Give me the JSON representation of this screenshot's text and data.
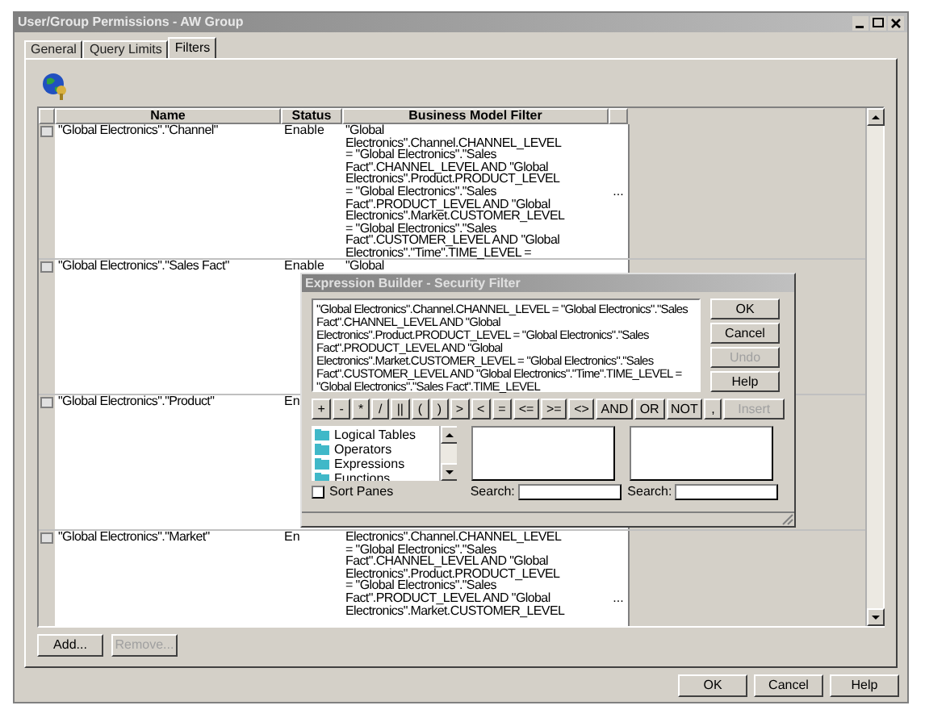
{
  "window": {
    "title": "User/Group Permissions - AW Group"
  },
  "tabs": [
    {
      "label": "General",
      "selected": false
    },
    {
      "label": "Query Limits",
      "selected": false
    },
    {
      "label": "Filters",
      "selected": true
    }
  ],
  "table": {
    "columns": [
      "Name",
      "Status",
      "Business Model Filter"
    ],
    "rows": [
      {
        "name": "\"Global Electronics\".\"Channel\"",
        "status": "Enable",
        "filter_lines": [
          "\"Global",
          "Electronics\".Channel.CHANNEL_LEVEL",
          "= \"Global Electronics\".\"Sales",
          "Fact\".CHANNEL_LEVEL AND \"Global",
          "Electronics\".Product.PRODUCT_LEVEL",
          "= \"Global Electronics\".\"Sales",
          "Fact\".PRODUCT_LEVEL AND \"Global",
          "Electronics\".Market.CUSTOMER_LEVEL",
          "= \"Global Electronics\".\"Sales",
          "Fact\".CUSTOMER_LEVEL AND \"Global",
          "Electronics\".\"Time\".TIME_LEVEL ="
        ],
        "edit_button": "..."
      },
      {
        "name": "\"Global Electronics\".\"Sales Fact\"",
        "status": "Enable",
        "filter_lines": [
          "\"Global"
        ]
      },
      {
        "name": "\"Global Electronics\".\"Product\"",
        "status": "En"
      },
      {
        "name": "\"Global Electronics\".\"Market\"",
        "status": "En",
        "filter_lines": [
          "Electronics\".Channel.CHANNEL_LEVEL",
          "= \"Global Electronics\".\"Sales",
          "Fact\".CHANNEL_LEVEL AND \"Global",
          "Electronics\".Product.PRODUCT_LEVEL",
          "= \"Global Electronics\".\"Sales",
          "Fact\".PRODUCT_LEVEL AND \"Global",
          "Electronics\".Market.CUSTOMER_LEVEL"
        ],
        "edit_button": "..."
      }
    ]
  },
  "list_buttons": [
    {
      "label": "Add...",
      "disabled": false
    },
    {
      "label": "Remove...",
      "disabled": true
    }
  ],
  "dialog": {
    "title": "Expression Builder - Security Filter",
    "expression": "\"Global Electronics\".Channel.CHANNEL_LEVEL = \"Global Electronics\".\"Sales Fact\".CHANNEL_LEVEL AND \"Global Electronics\".Product.PRODUCT_LEVEL = \"Global Electronics\".\"Sales Fact\".PRODUCT_LEVEL AND \"Global Electronics\".Market.CUSTOMER_LEVEL = \"Global Electronics\".\"Sales Fact\".CUSTOMER_LEVEL AND \"Global Electronics\".\"Time\".TIME_LEVEL = \"Global Electronics\".\"Sales Fact\".TIME_LEVEL",
    "side_buttons": [
      {
        "label": "OK",
        "disabled": false
      },
      {
        "label": "Cancel",
        "disabled": false
      },
      {
        "label": "Undo",
        "disabled": true
      },
      {
        "label": "Help",
        "disabled": false
      }
    ],
    "operators": [
      "+",
      "-",
      "*",
      "/",
      "||",
      "(",
      ")",
      ">",
      "<",
      "=",
      "<=",
      ">=",
      "<>",
      "AND",
      "OR",
      "NOT",
      ","
    ],
    "insert_button": {
      "label": "Insert",
      "disabled": true
    },
    "categories": [
      "Logical Tables",
      "Operators",
      "Expressions",
      "Functions"
    ],
    "sort_panes": {
      "label": "Sort Panes",
      "checked": false
    },
    "search_fields": [
      {
        "label": "Search:"
      },
      {
        "label": "Search:"
      }
    ]
  },
  "footer_buttons": [
    {
      "label": "OK",
      "disabled": false
    },
    {
      "label": "Cancel",
      "disabled": false
    },
    {
      "label": "Help",
      "disabled": false
    }
  ]
}
